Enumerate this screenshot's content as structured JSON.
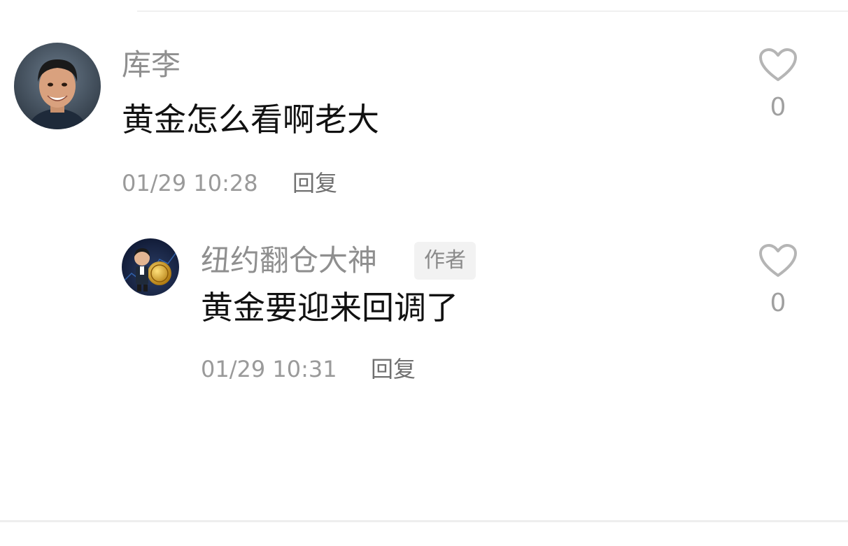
{
  "comments": [
    {
      "username": "库李",
      "text": "黄金怎么看啊老大",
      "timestamp": "01/29 10:28",
      "reply_label": "回复",
      "like_count": "0",
      "is_author": false
    },
    {
      "username": "纽约翻仓大神",
      "badge": "作者",
      "text": "黄金要迎来回调了",
      "timestamp": "01/29 10:31",
      "reply_label": "回复",
      "like_count": "0",
      "is_author": true
    }
  ],
  "icons": {
    "like": "heart-outline-icon"
  },
  "colors": {
    "username": "#8f8f8f",
    "text": "#111111",
    "meta": "#9a9a9a",
    "reply": "#707070",
    "heart": "#b5b5b5",
    "badge_bg": "#f2f2f2"
  }
}
